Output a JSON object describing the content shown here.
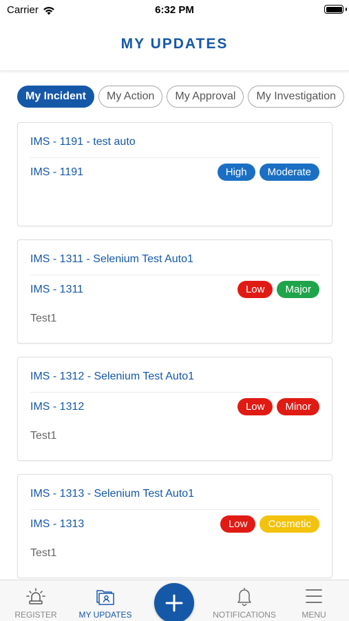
{
  "status_bar": {
    "carrier": "Carrier",
    "time": "6:32 PM"
  },
  "header": {
    "title": "MY UPDATES"
  },
  "tabs": [
    {
      "label": "My Incident",
      "active": true
    },
    {
      "label": "My Action",
      "active": false
    },
    {
      "label": "My Approval",
      "active": false
    },
    {
      "label": "My Investigation",
      "active": false
    }
  ],
  "cards": [
    {
      "title": "IMS - 1191 - test auto",
      "code": "IMS - 1191",
      "badges": [
        {
          "label": "High",
          "color": "#1a6fc4"
        },
        {
          "label": "Moderate",
          "color": "#1a6fc4"
        }
      ],
      "description": ""
    },
    {
      "title": "IMS - 1311 - Selenium Test  Auto1",
      "code": "IMS - 1311",
      "badges": [
        {
          "label": "Low",
          "color": "#e01b14"
        },
        {
          "label": "Major",
          "color": "#1fa44b"
        }
      ],
      "description": "Test1"
    },
    {
      "title": "IMS - 1312 - Selenium Test  Auto1",
      "code": "IMS - 1312",
      "badges": [
        {
          "label": "Low",
          "color": "#e01b14"
        },
        {
          "label": "Minor",
          "color": "#e01b14"
        }
      ],
      "description": "Test1"
    },
    {
      "title": "IMS - 1313 - Selenium Test  Auto1",
      "code": "IMS - 1313",
      "badges": [
        {
          "label": "Low",
          "color": "#e01b14"
        },
        {
          "label": "Cosmetic",
          "color": "#f3c20d"
        }
      ],
      "description": "Test1"
    }
  ],
  "bottom_nav": {
    "register": {
      "label": "REGISTER",
      "icon": "alarm-light-icon"
    },
    "my_updates": {
      "label": "MY UPDATES",
      "icon": "folder-user-icon"
    },
    "add": {
      "icon": "plus-icon"
    },
    "notifications": {
      "label": "NOTIFICATIONS",
      "icon": "bell-icon"
    },
    "menu": {
      "label": "MENU",
      "icon": "hamburger-icon"
    }
  },
  "colors": {
    "primary": "#1558a8",
    "inactive": "#888888"
  }
}
